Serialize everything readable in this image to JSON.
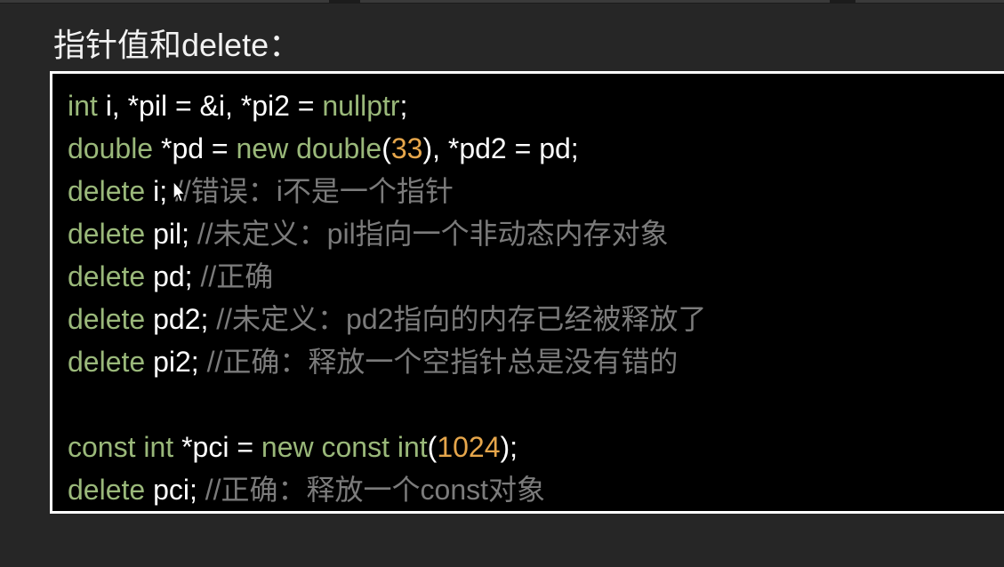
{
  "slide": {
    "title": "指针值和delete："
  },
  "code": {
    "lines": [
      [
        {
          "t": "int",
          "c": "kw"
        },
        {
          "t": " i, *pil = &i, *pi2 = ",
          "c": "id"
        },
        {
          "t": "nullptr",
          "c": "kw"
        },
        {
          "t": ";",
          "c": "id"
        }
      ],
      [
        {
          "t": "double",
          "c": "kw"
        },
        {
          "t": " *pd = ",
          "c": "id"
        },
        {
          "t": "new double",
          "c": "kw"
        },
        {
          "t": "(",
          "c": "id"
        },
        {
          "t": "33",
          "c": "num"
        },
        {
          "t": "), *pd2 = pd;",
          "c": "id"
        }
      ],
      [
        {
          "t": "delete",
          "c": "kw"
        },
        {
          "t": " i; ",
          "c": "id"
        },
        {
          "t": "//错误：i不是一个指针",
          "c": "cm"
        }
      ],
      [
        {
          "t": "delete",
          "c": "kw"
        },
        {
          "t": " pil; ",
          "c": "id"
        },
        {
          "t": "//未定义：pil指向一个非动态内存对象",
          "c": "cm"
        }
      ],
      [
        {
          "t": "delete",
          "c": "kw"
        },
        {
          "t": " pd; ",
          "c": "id"
        },
        {
          "t": "//正确",
          "c": "cm"
        }
      ],
      [
        {
          "t": "delete",
          "c": "kw"
        },
        {
          "t": " pd2; ",
          "c": "id"
        },
        {
          "t": "//未定义：pd2指向的内存已经被释放了",
          "c": "cm"
        }
      ],
      [
        {
          "t": "delete",
          "c": "kw"
        },
        {
          "t": " pi2; ",
          "c": "id"
        },
        {
          "t": "//正确：释放一个空指针总是没有错的",
          "c": "cm"
        }
      ],
      [],
      [
        {
          "t": "const int",
          "c": "kw"
        },
        {
          "t": " *pci = ",
          "c": "id"
        },
        {
          "t": "new const int",
          "c": "kw"
        },
        {
          "t": "(",
          "c": "id"
        },
        {
          "t": "1024",
          "c": "num"
        },
        {
          "t": ");",
          "c": "id"
        }
      ],
      [
        {
          "t": "delete",
          "c": "kw"
        },
        {
          "t": " pci; ",
          "c": "id"
        },
        {
          "t": "//正确：释放一个const对象",
          "c": "cm"
        }
      ]
    ]
  },
  "colors": {
    "background": "#262626",
    "code_background": "#000000",
    "code_border": "#ffffff",
    "keyword": "#9ab87a",
    "number": "#e6a64b",
    "identifier": "#ffffff",
    "comment": "#7b7b7b"
  },
  "cursor": {
    "icon": "mouse-pointer-icon"
  }
}
